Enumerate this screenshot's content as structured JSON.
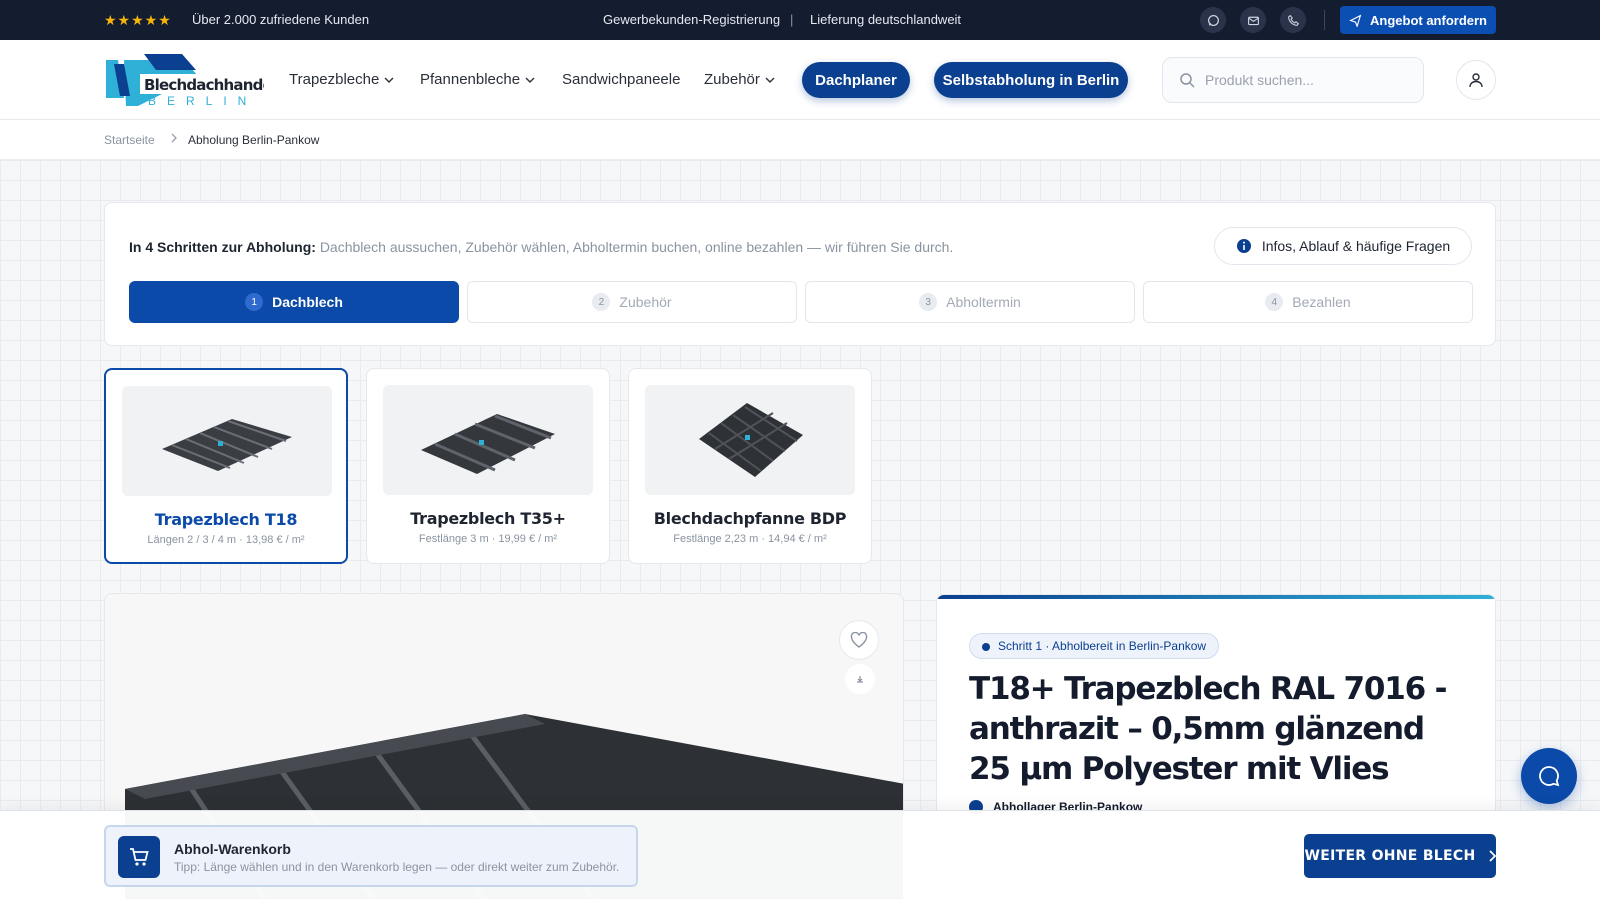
{
  "topbar": {
    "stars": "★★★★★",
    "rating_text": "Über 2.000 zufriedene Kunden",
    "link_business": "Gewerbekunden-Registrierung",
    "separator": "|",
    "delivery": "Lieferung deutschlandweit",
    "offer_button": "Angebot anfordern"
  },
  "header": {
    "logo_text": "Blechdachhandel",
    "logo_sub": "BERLIN",
    "nav": [
      {
        "label": "Trapezbleche",
        "has_dropdown": true
      },
      {
        "label": "Pfannenbleche",
        "has_dropdown": true
      },
      {
        "label": "Sandwichpaneele",
        "has_dropdown": false
      },
      {
        "label": "Zubehör",
        "has_dropdown": true
      }
    ],
    "pill_planner": "Dachplaner",
    "pill_pickup": "Selbstabholung in Berlin",
    "search_placeholder": "Produkt suchen..."
  },
  "breadcrumb": {
    "home": "Startseite",
    "current": "Abholung Berlin-Pankow"
  },
  "steps": {
    "intro_bold": "In 4 Schritten zur Abholung:",
    "intro_text": "Dachblech aussuchen, Zubehör wählen, Abholtermin buchen, online bezahlen — wir führen Sie durch.",
    "faq_button": "Infos, Ablauf & häufige Fragen",
    "items": [
      {
        "num": "1",
        "label": "Dachblech",
        "active": true
      },
      {
        "num": "2",
        "label": "Zubehör",
        "active": false
      },
      {
        "num": "3",
        "label": "Abholtermin",
        "active": false
      },
      {
        "num": "4",
        "label": "Bezahlen",
        "active": false
      }
    ]
  },
  "products": [
    {
      "name": "Trapezblech T18",
      "sub": "Längen 2 / 3 / 4 m · 13,98 € / m²",
      "selected": true
    },
    {
      "name": "Trapezblech T35+",
      "sub": "Festlänge 3 m · 19,99 € / m²",
      "selected": false
    },
    {
      "name": "Blechdachpfanne BDP",
      "sub": "Festlänge 2,23 m · 14,94 € / m²",
      "selected": false
    }
  ],
  "product_detail": {
    "badge": "Schritt 1 · Abholbereit in Berlin-Pankow",
    "title": "T18+ Trapezblech RAL 7016 - anthrazit – 0,5mm glänzend 25 µm Polyester mit Vlies",
    "location": "Abhollager Berlin-Pankow"
  },
  "cart": {
    "title": "Abhol-Warenkorb",
    "tip": "Tipp: Länge wählen und in den Warenkorb legen — oder direkt weiter zum Zubehör.",
    "next_button": "WEITER OHNE BLECH"
  },
  "colors": {
    "primary": "#0b3f8f",
    "accent": "#0b4aa8",
    "topbar": "#141c30",
    "star": "#f5b50a"
  }
}
